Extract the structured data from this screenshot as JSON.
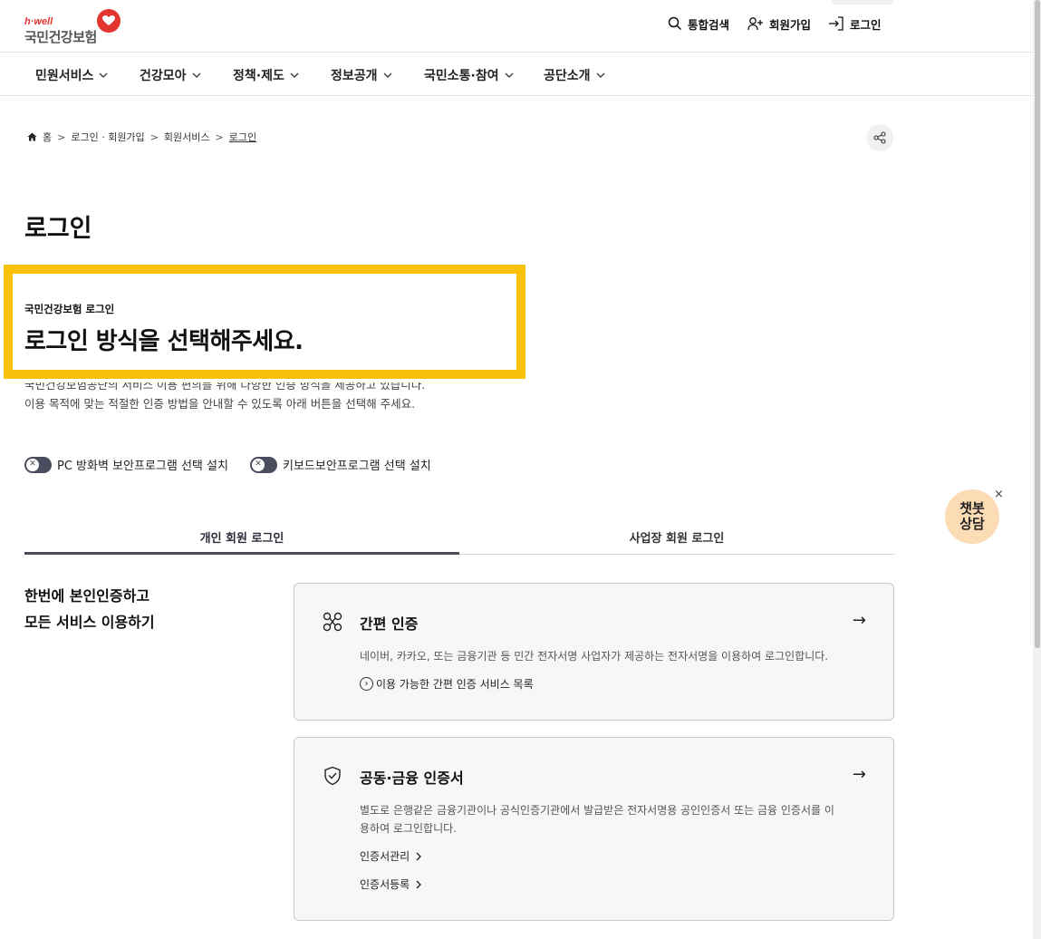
{
  "header": {
    "logo_sub": "h·well",
    "logo_main": "국민건강보험",
    "search_label": "통합검색",
    "join_label": "회원가입",
    "login_label": "로그인"
  },
  "nav": {
    "items": [
      {
        "label": "민원서비스"
      },
      {
        "label": "건강모아"
      },
      {
        "label": "정책·제도"
      },
      {
        "label": "정보공개"
      },
      {
        "label": "국민소통·참여"
      },
      {
        "label": "공단소개"
      }
    ]
  },
  "breadcrumb": {
    "home": "홈",
    "items": [
      "로그인 · 회원가입",
      "회원서비스",
      "로그인"
    ]
  },
  "page": {
    "title": "로그인",
    "highlight_sub": "국민건강보험 로그인",
    "highlight_title": "로그인 방식을 선택해주세요.",
    "desc_line1": "국민건강보험공단의 서비스 이용 편의를 위해 다양한 인증 방식을 제공하고 있습니다.",
    "desc_line2": "이용 목적에 맞는 적절한 인증 방법을 안내할 수 있도록 아래 버튼을 선택해 주세요."
  },
  "toggles": {
    "pc_firewall": "PC 방화벽 보안프로그램 선택 설치",
    "keyboard_security": "키보드보안프로그램 선택 설치"
  },
  "tabs": {
    "personal": "개인 회원 로그인",
    "business": "사업장 회원 로그인"
  },
  "side": {
    "line1": "한번에 본인인증하고",
    "line2": "모든 서비스 이용하기"
  },
  "cards": {
    "simple": {
      "title": "간편 인증",
      "desc": "네이버, 카카오, 또는 금융기관 등 민간 전자서명 사업자가 제공하는 전자서명을 이용하여 로그인합니다.",
      "link": "이용 가능한 간편 인증 서비스 목록",
      "arrow": "→"
    },
    "cert": {
      "title": "공동·금융 인증서",
      "desc_line1": "별도로 은행같은 금융기관이나 공식인증기관에서 발급받은 전자서명용 공인인증서 또는 금융 인증서를 이",
      "desc_line2": "용하여 로그인합니다.",
      "link1": "인증서관리",
      "link2": "인증서등록",
      "arrow": "→"
    }
  },
  "chatbot": {
    "line1": "챗봇",
    "line2": "상담",
    "close": "×"
  },
  "colors": {
    "highlight_border": "#f9c10a",
    "brand_red": "#e3342f",
    "toggle_bg": "#4a4d5e",
    "chatbot_bg": "#fcdcb4"
  }
}
